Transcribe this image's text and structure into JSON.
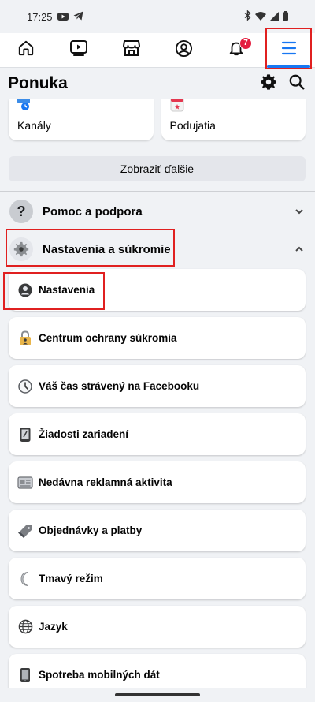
{
  "status_bar": {
    "time": "17:25"
  },
  "nav": {
    "items": [
      {
        "name": "home",
        "icon": "home-icon"
      },
      {
        "name": "watch",
        "icon": "video-icon"
      },
      {
        "name": "marketplace",
        "icon": "shop-icon"
      },
      {
        "name": "profile",
        "icon": "profile-icon"
      },
      {
        "name": "notifications",
        "icon": "bell-icon",
        "badge": "7"
      },
      {
        "name": "menu",
        "icon": "menu-icon",
        "active": true
      }
    ],
    "accent": "#1877f2",
    "badge_color": "#e41e3f"
  },
  "header": {
    "title": "Ponuka"
  },
  "shortcuts": [
    {
      "label": "Kanály"
    },
    {
      "label": "Podujatia"
    }
  ],
  "see_more_label": "Zobraziť ďalšie",
  "sections": {
    "help": {
      "label": "Pomoc a podpora",
      "expanded": false
    },
    "settings_privacy": {
      "label": "Nastavenia a súkromie",
      "expanded": true
    }
  },
  "settings_items": [
    {
      "label": "Nastavenia",
      "icon": "profile-icon"
    },
    {
      "label": "Centrum ochrany súkromia",
      "icon": "lock-icon"
    },
    {
      "label": "Váš čas strávený na Facebooku",
      "icon": "clock-icon"
    },
    {
      "label": "Žiadosti zariadení",
      "icon": "device-icon"
    },
    {
      "label": "Nedávna reklamná aktivita",
      "icon": "ad-icon"
    },
    {
      "label": "Objednávky a platby",
      "icon": "tag-icon"
    },
    {
      "label": "Tmavý režim",
      "icon": "moon-icon"
    },
    {
      "label": "Jazyk",
      "icon": "globe-icon"
    },
    {
      "label": "Spotreba mobilných dát",
      "icon": "phone-icon"
    }
  ],
  "highlight_color": "#e02020"
}
